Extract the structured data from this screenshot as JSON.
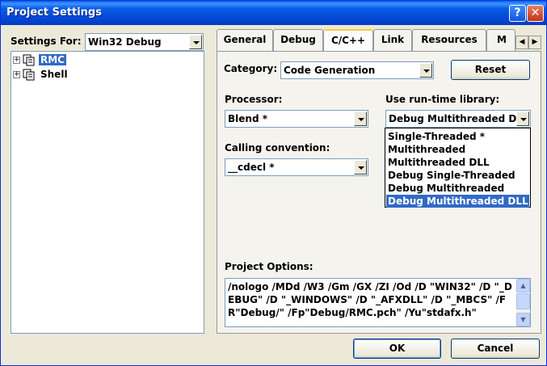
{
  "window": {
    "title": "Project Settings",
    "help_glyph": "?",
    "close_glyph": "✕"
  },
  "settings_for": {
    "label": "Settings For:",
    "value": "Win32 Debug"
  },
  "tree": {
    "items": [
      {
        "label": "RMC",
        "selected": true,
        "expander": "+"
      },
      {
        "label": "Shell",
        "selected": false,
        "expander": "+"
      }
    ]
  },
  "tabs": {
    "items": [
      "General",
      "Debug",
      "C/C++",
      "Link",
      "Resources",
      "M"
    ],
    "active": "C/C++",
    "scroll_left": "◀",
    "scroll_right": "▶"
  },
  "category": {
    "label": "Category:",
    "value": "Code Generation"
  },
  "reset_button": {
    "label": "Reset"
  },
  "processor": {
    "label": "Processor:",
    "value": "Blend *"
  },
  "runtime_library": {
    "label": "Use run-time library:",
    "value": "Debug Multithreaded DL",
    "options": [
      "Single-Threaded *",
      "Multithreaded",
      "Multithreaded DLL",
      "Debug Single-Threaded",
      "Debug Multithreaded",
      "Debug Multithreaded DLL"
    ],
    "selected_index": 5
  },
  "calling_convention": {
    "label": "Calling convention:",
    "value": "__cdecl *"
  },
  "project_options": {
    "label": "Project Options:",
    "text": "/nologo /MDd /W3 /Gm /GX /ZI /Od /D \"WIN32\" /D \"_DEBUG\" /D \"_WINDOWS\" /D \"_AFXDLL\" /D \"_MBCS\" /FR\"Debug/\" /Fp\"Debug/RMC.pch\" /Yu\"stdafx.h\""
  },
  "buttons": {
    "ok": "OK",
    "cancel": "Cancel"
  },
  "colors": {
    "titlebar": "#0a5fe8",
    "selection": "#316ac5",
    "dialog_bg": "#ece9d8"
  }
}
